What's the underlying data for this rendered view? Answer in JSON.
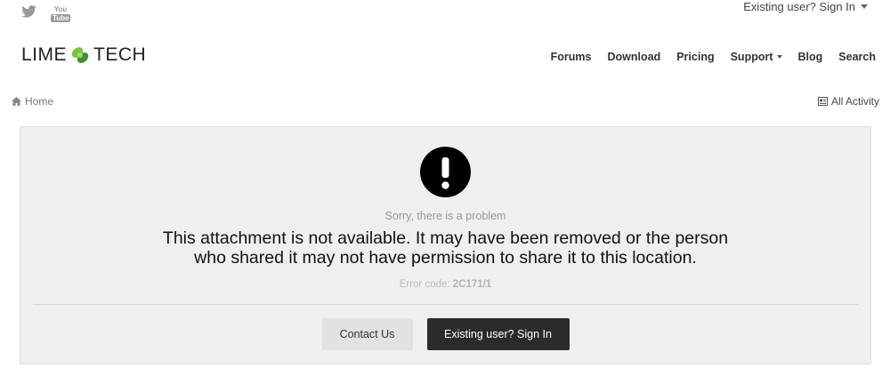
{
  "header": {
    "social": [
      {
        "icon": "twitter-icon"
      },
      {
        "icon": "youtube-icon",
        "top": "You",
        "bottom": "Tube"
      }
    ],
    "signin_link": "Existing user? Sign In",
    "logo": {
      "left": "LIME",
      "right": "TECH"
    },
    "nav": [
      "Forums",
      "Download",
      "Pricing",
      "Support",
      "Blog",
      "Search"
    ]
  },
  "breadcrumb": {
    "home": "Home"
  },
  "activity_link": "All Activity",
  "error": {
    "subtitle": "Sorry, there is a problem",
    "message_line1": "This attachment is not available. It may have been removed or the person",
    "message_line2": "who shared it may not have permission to share it to this location.",
    "code_label": "Error code:",
    "code_value": "2C171/1",
    "contact_button": "Contact Us",
    "signin_button": "Existing user? Sign In"
  },
  "colors": {
    "accent_green": "#5aa83a",
    "dark_button": "#2b2b2b",
    "panel_bg": "#efefef"
  }
}
